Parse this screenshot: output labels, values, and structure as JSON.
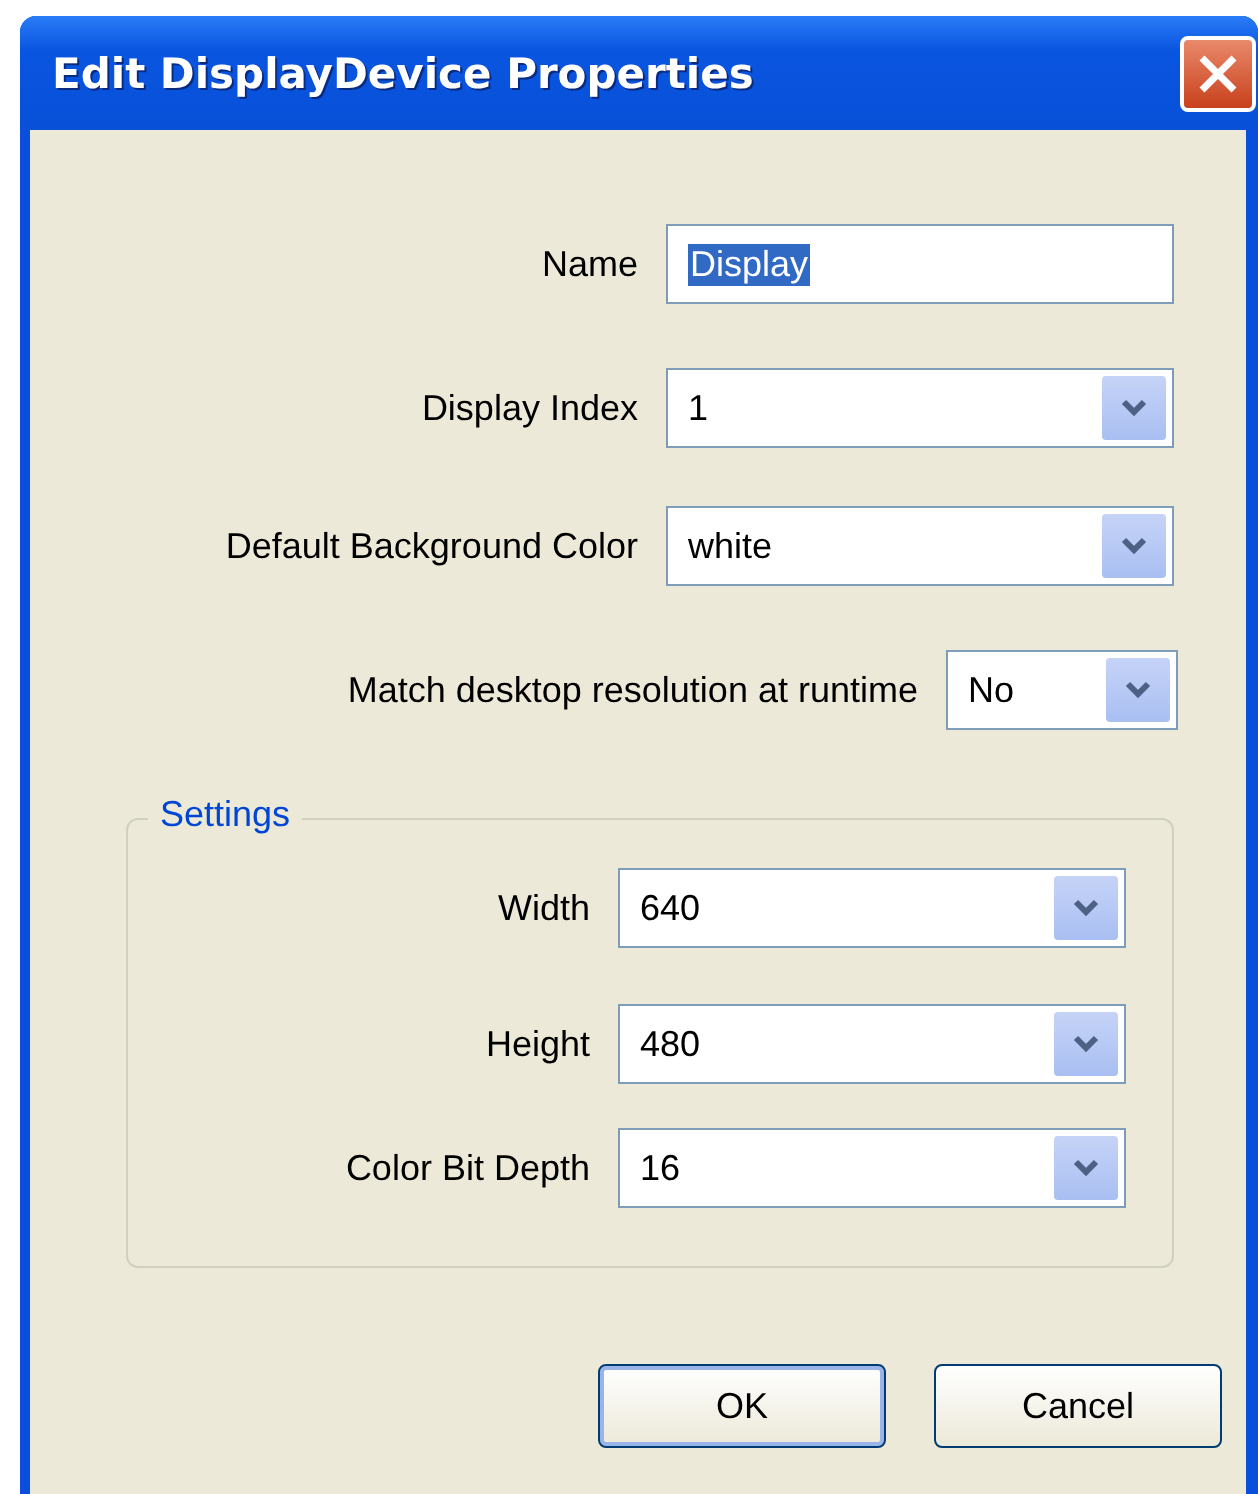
{
  "window": {
    "title": "Edit DisplayDevice Properties"
  },
  "fields": [
    {
      "kind": "text",
      "label": "Name",
      "value": "Display",
      "text_selected": true
    },
    {
      "kind": "select",
      "label": "Display Index",
      "value": "1"
    },
    {
      "kind": "select",
      "label": "Default Background Color",
      "value": "white"
    },
    {
      "kind": "select_small",
      "label": "Match desktop resolution at runtime",
      "value": "No"
    }
  ],
  "settings": {
    "legend": "Settings",
    "fields": [
      {
        "kind": "select",
        "label": "Width",
        "value": "640"
      },
      {
        "kind": "select",
        "label": "Height",
        "value": "480"
      },
      {
        "kind": "select",
        "label": "Color Bit Depth",
        "value": "16"
      }
    ]
  },
  "buttons": [
    {
      "label": "OK",
      "default": true
    },
    {
      "label": "Cancel",
      "default": false
    }
  ]
}
